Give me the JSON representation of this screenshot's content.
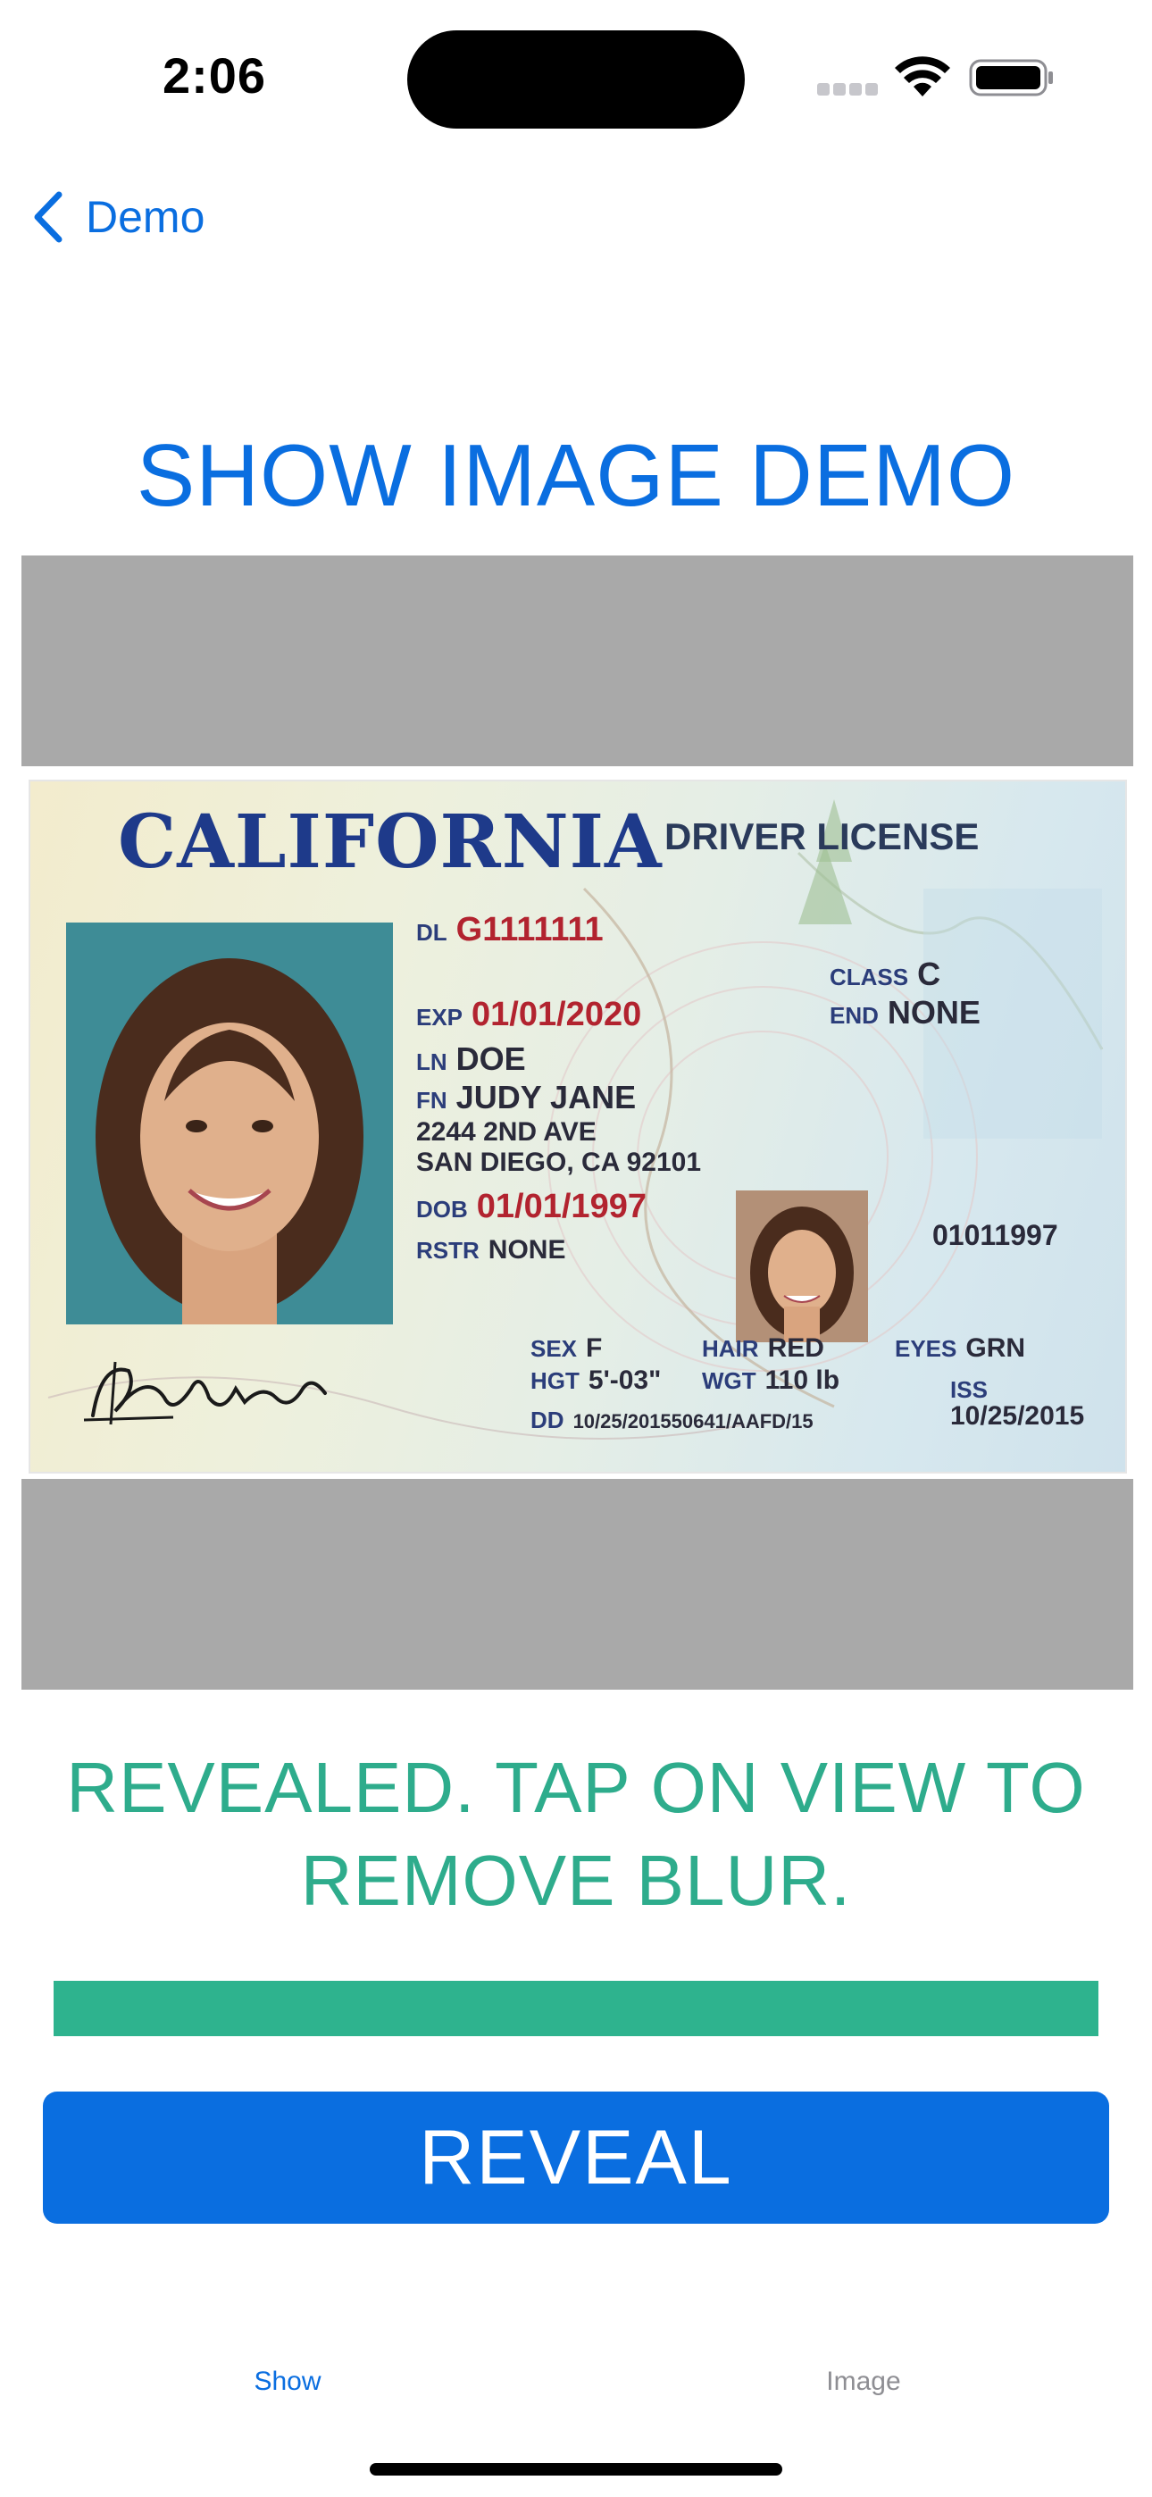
{
  "status_bar": {
    "time": "2:06"
  },
  "nav": {
    "back_label": "Demo"
  },
  "page": {
    "title": "SHOW IMAGE DEMO",
    "message": "REVEALED. TAP ON VIEW TO REMOVE BLUR.",
    "reveal_button": "REVEAL"
  },
  "license": {
    "state": "CALIFORNIA",
    "document_type": "DRIVER LICENSE",
    "dl_label": "DL",
    "dl_number": "G1111111",
    "exp_label": "EXP",
    "exp_date": "01/01/2020",
    "ln_label": "LN",
    "last_name": "DOE",
    "fn_label": "FN",
    "first_name": "JUDY JANE",
    "address_line1": "2244 2ND AVE",
    "address_line2": "SAN DIEGO, CA 92101",
    "dob_label": "DOB",
    "dob": "01/01/1997",
    "rstr_label": "RSTR",
    "rstr": "NONE",
    "class_label": "CLASS",
    "class": "C",
    "end_label": "END",
    "end": "NONE",
    "id_code": "01011997",
    "sex_label": "SEX",
    "sex": "F",
    "hgt_label": "HGT",
    "hgt": "5'-03\"",
    "hair_label": "HAIR",
    "hair": "RED",
    "wgt_label": "WGT",
    "wgt": "110 lb",
    "eyes_label": "EYES",
    "eyes": "GRN",
    "iss_label": "ISS",
    "iss": "10/25/2015",
    "dd_label": "DD",
    "dd": "10/25/201550641/AAFD/15"
  },
  "tabs": [
    {
      "label": "Show",
      "selected": true
    },
    {
      "label": "Image",
      "selected": false
    }
  ],
  "colors": {
    "accent": "#0a6ee0",
    "message_green": "#2eac8c",
    "placeholder_gray": "#a9a9a9",
    "tab_inactive": "#8e8e93"
  },
  "icons": {
    "back": "chevron-left-icon",
    "wifi": "wifi-icon",
    "battery": "battery-icon",
    "signal": "cellular-signal-icon"
  }
}
